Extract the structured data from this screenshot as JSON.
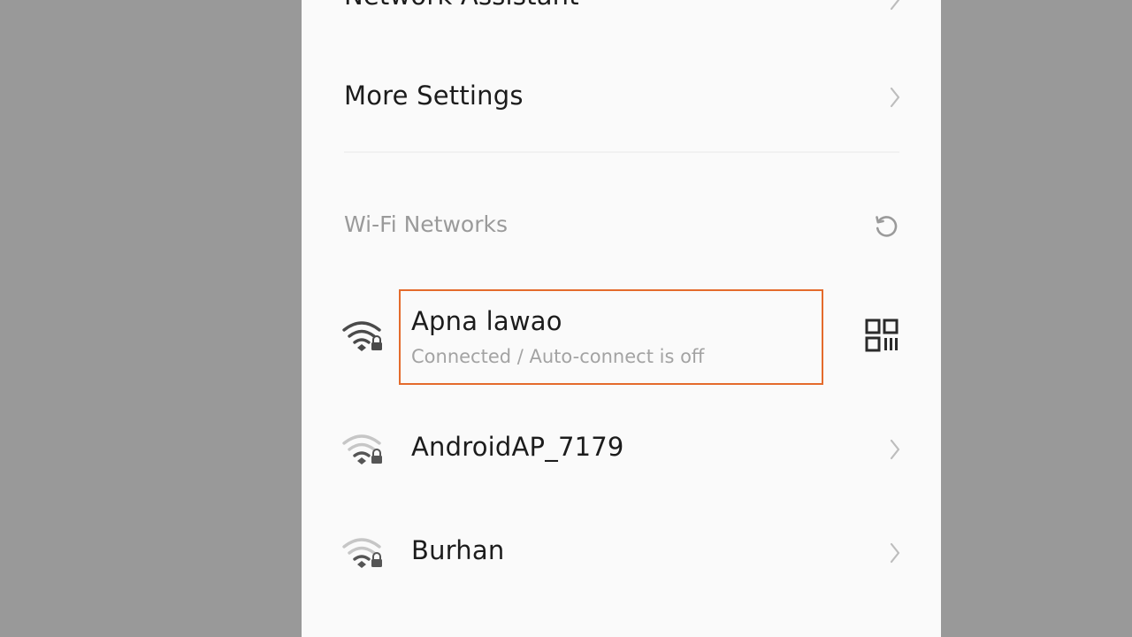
{
  "colors": {
    "side_background": "#999999",
    "panel_background": "#fafafa",
    "highlight_border": "#e46b2c",
    "text_primary": "#1c1c1c",
    "text_secondary": "#a3a3a3"
  },
  "settings": {
    "partial_item_label": "Network Assistant",
    "more_settings_label": "More Settings"
  },
  "wifi_section": {
    "title": "Wi-Fi Networks",
    "refresh_icon": "refresh-icon"
  },
  "networks": [
    {
      "name": "Apna lawao",
      "status": "Connected / Auto-connect is off",
      "connected": true,
      "secured": true,
      "signal_level": 3,
      "action_icon": "qr-code-icon"
    },
    {
      "name": "AndroidAP_7179",
      "secured": true,
      "signal_level": 1,
      "action_icon": "chevron-right-icon"
    },
    {
      "name": "Burhan",
      "secured": true,
      "signal_level": 1,
      "action_icon": "chevron-right-icon"
    }
  ]
}
